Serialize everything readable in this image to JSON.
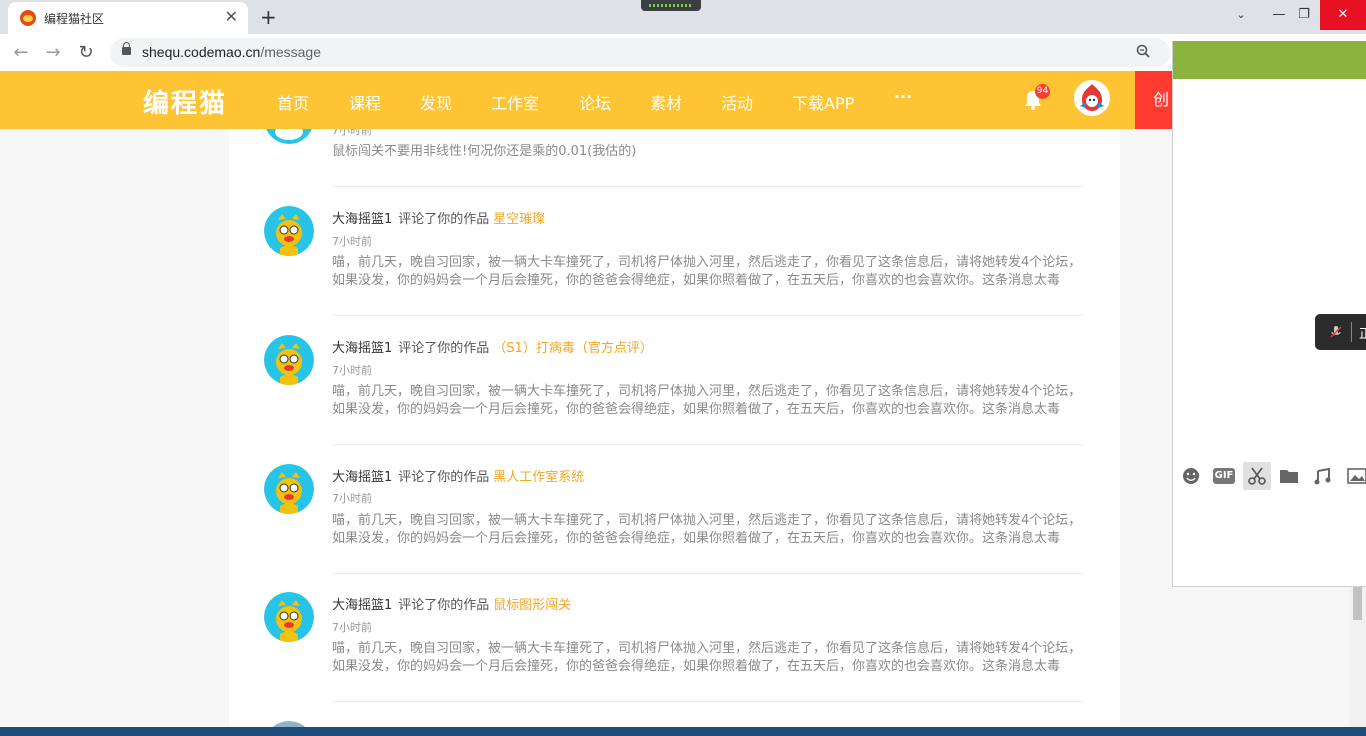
{
  "browser": {
    "tab_title": "编程猫社区",
    "tab_close": "✕",
    "new_tab": "+",
    "url_host": "shequ.codemao.cn",
    "url_path": "/message",
    "back": "←",
    "forward": "→",
    "reload": "↻",
    "minimize": "—",
    "restore": "❐",
    "close": "✕"
  },
  "site": {
    "logo": "编程猫",
    "nav": [
      "首页",
      "课程",
      "发现",
      "工作室",
      "论坛",
      "素材",
      "活动",
      "下载APP",
      "···"
    ],
    "notification_count": "94",
    "create_label": "创"
  },
  "messages": [
    {
      "user": "",
      "action": "",
      "work": "",
      "time": "7小时前",
      "body": "鼠标闯关不要用非线性!何况你还是乘的0.01(我估的)"
    },
    {
      "user": "大海摇篮1",
      "action": "评论了你的作品",
      "work": "星空璀璨",
      "time": "7小时前",
      "body": "喵，前几天，晚自习回家，被一辆大卡车撞死了，司机将尸体抛入河里，然后逃走了，你看见了这条信息后，请将她转发4个论坛，如果没发，你的妈妈会一个月后会撞死，你的爸爸会得绝症，如果你照着做了，在五天后，你喜欢的也会喜欢你。这条消息太毒了，我不..."
    },
    {
      "user": "大海摇篮1",
      "action": "评论了你的作品",
      "work": "（S1）打病毒（官方点评）",
      "time": "7小时前",
      "body": "喵，前几天，晚自习回家，被一辆大卡车撞死了，司机将尸体抛入河里，然后逃走了，你看见了这条信息后，请将她转发4个论坛，如果没发，你的妈妈会一个月后会撞死，你的爸爸会得绝症，如果你照着做了，在五天后，你喜欢的也会喜欢你。这条消息太毒了，我不..."
    },
    {
      "user": "大海摇篮1",
      "action": "评论了你的作品",
      "work": "黑人工作室系统",
      "time": "7小时前",
      "body": "喵，前几天，晚自习回家，被一辆大卡车撞死了，司机将尸体抛入河里，然后逃走了，你看见了这条信息后，请将她转发4个论坛，如果没发，你的妈妈会一个月后会撞死，你的爸爸会得绝症，如果你照着做了，在五天后，你喜欢的也会喜欢你。这条消息太毒了，我不..."
    },
    {
      "user": "大海摇篮1",
      "action": "评论了你的作品",
      "work": "鼠标图形闯关",
      "time": "7小时前",
      "body": "喵，前几天，晚自习回家，被一辆大卡车撞死了，司机将尸体抛入河里，然后逃走了，你看见了这条信息后，请将她转发4个论坛，如果没发，你的妈妈会一个月后会撞死，你的爸爸会得绝症，如果你照着做了，在五天后，你喜欢的也会喜欢你。这条消息太毒了，我不..."
    }
  ],
  "side_panel": {
    "mic_text": "正",
    "tools": [
      "emoji-icon",
      "gif-icon",
      "scissors-icon",
      "folder-icon",
      "music-icon",
      "image-icon"
    ],
    "gif_label": "GIF"
  },
  "colors": {
    "header": "#fec433",
    "accent_link": "#f5a623",
    "create": "#ff3b30",
    "side_top": "#8ab43e"
  }
}
